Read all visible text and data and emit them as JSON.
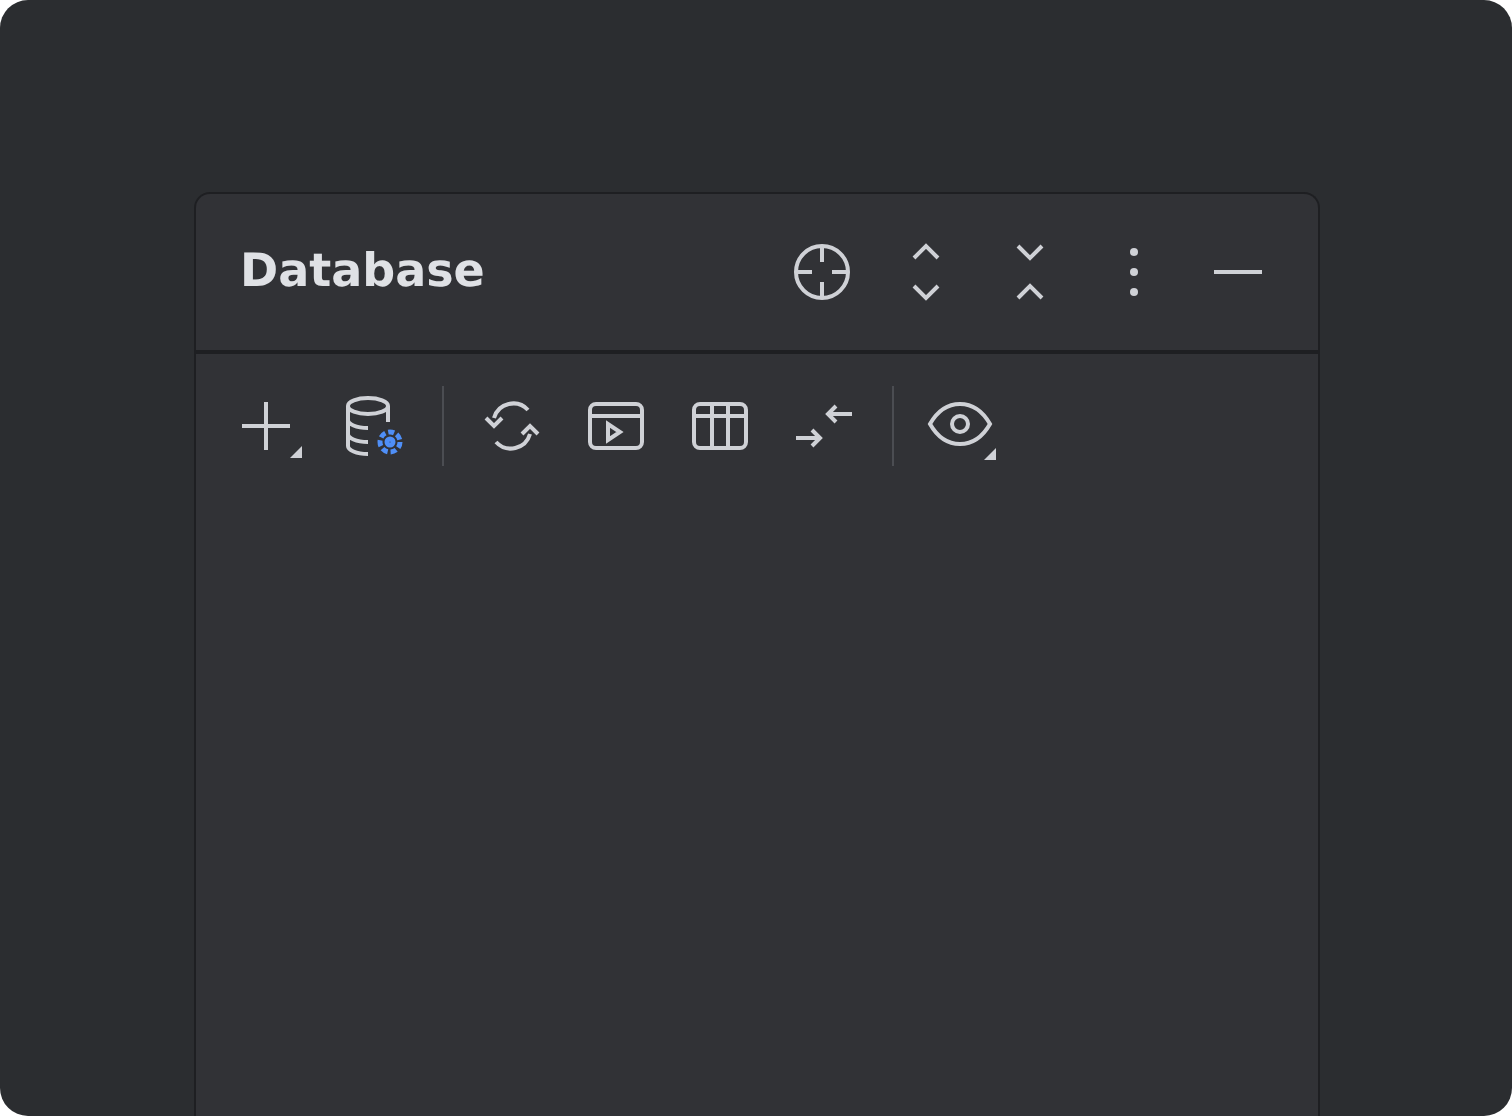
{
  "panel": {
    "title": "Database"
  }
}
